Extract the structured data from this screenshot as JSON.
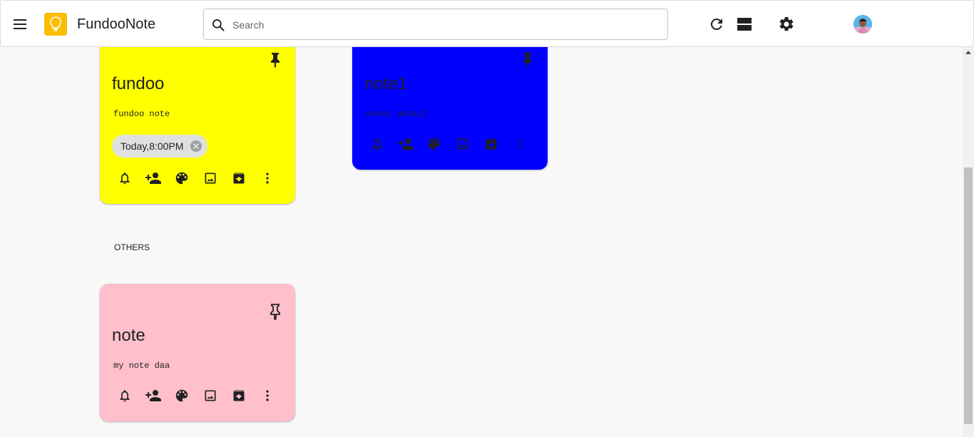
{
  "header": {
    "app_title": "FundooNote",
    "search_placeholder": "Search"
  },
  "icons": {
    "menu": "menu-icon",
    "logo": "lightbulb-icon",
    "search": "search-icon",
    "refresh": "refresh-icon",
    "view": "list-view-icon",
    "settings": "gear-icon",
    "avatar": "avatar"
  },
  "pinned_notes": [
    {
      "title": "fundoo",
      "body": "fundoo note",
      "reminder": "Today,8:00PM",
      "color": "#ffff00",
      "pinned": true
    },
    {
      "title": "note1",
      "body": "note1 detail",
      "color": "#0000ff",
      "pinned": true
    }
  ],
  "sections": {
    "others_label": "OTHERS"
  },
  "other_notes": [
    {
      "title": "note",
      "body": "my note daa",
      "color": "#ffc0cb",
      "pinned": false
    }
  ],
  "note_actions": [
    "bell-icon",
    "add-collaborator-icon",
    "palette-icon",
    "image-icon",
    "archive-icon",
    "more-vert-icon"
  ]
}
